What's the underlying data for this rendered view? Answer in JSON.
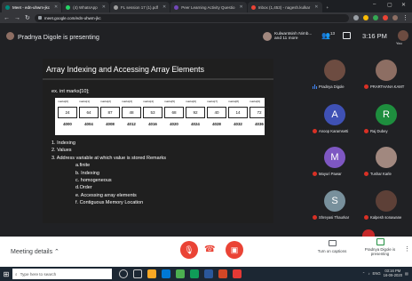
{
  "browser": {
    "tabs": [
      {
        "label": "Meet - edn-uhwm-jkc",
        "color": "#00897b",
        "active": true
      },
      {
        "label": "(4) WhatsApp",
        "color": "#25d366",
        "active": false
      },
      {
        "label": "FL session 17 (1).pdf",
        "color": "#9e9e9e",
        "active": false
      },
      {
        "label": "Peer Learning Activity Questio",
        "color": "#7248b9",
        "active": false
      },
      {
        "label": "Inbox (1,453) - nagesh.kulkar",
        "color": "#ea4335",
        "active": false
      }
    ],
    "new_tab": "+",
    "url": "meet.google.com/edn-uhwm-jkc"
  },
  "meet": {
    "presenter_label": "Pradnya Digole is presenting",
    "participants_chip": "Kulwantsinh Nimb... and 11 more",
    "people_count": "13",
    "time": "3:16 PM",
    "you_label": "You",
    "meeting_details": "Meeting details",
    "captions_label": "Turn on captions",
    "presenting_label": "Pradnya Digole is presenting"
  },
  "slide": {
    "title": "Array Indexing and Accessing Array Elements",
    "example": "ex. int marks[10];",
    "headers": [
      "marks[0]",
      "marks[1]",
      "marks[2]",
      "marks[3]",
      "marks[4]",
      "marks[5]",
      "marks[6]",
      "marks[7]",
      "marks[8]",
      "marks[9]"
    ],
    "values": [
      "24",
      "64",
      "87",
      "48",
      "53",
      "68",
      "92",
      "40",
      "14",
      "72"
    ],
    "addresses": [
      "4000",
      "4004",
      "4008",
      "4012",
      "4016",
      "4020",
      "4024",
      "4028",
      "4032",
      "4036"
    ],
    "points": [
      "1. Indexing",
      "2. Values",
      "3. Address variable at which value is stored Remarks"
    ],
    "subpoints": [
      "a.finite",
      "b. Indexing",
      "c. homogeneous",
      "d.Order",
      "e. Accessing array elements",
      "f. Contiguous Memory Location"
    ]
  },
  "participants": [
    {
      "name": "Pradnya Digole",
      "initial": "",
      "color": "#6d4c41",
      "muted": false
    },
    {
      "name": "PRARTHANA KAMT",
      "initial": "",
      "color": "#8d6e63",
      "muted": true
    },
    {
      "name": "Anoop Karamsetti",
      "initial": "A",
      "color": "#3f51b5",
      "muted": true
    },
    {
      "name": "Raj Dubey",
      "initial": "R",
      "color": "#1e8e3e",
      "muted": true
    },
    {
      "name": "Mayuri Pawar",
      "initial": "M",
      "color": "#7e57c2",
      "muted": true
    },
    {
      "name": "Tushar Karle",
      "initial": "",
      "color": "#a1887f",
      "muted": true
    },
    {
      "name": "Shreyasi Thaurkar",
      "initial": "S",
      "color": "#78909c",
      "muted": true
    },
    {
      "name": "Kalpesh sonawane",
      "initial": "",
      "color": "#5d4037",
      "muted": true
    }
  ],
  "taskbar": {
    "search_placeholder": "Type here to search",
    "tray_lang": "ENG",
    "tray_time": "03:16 PM",
    "tray_date": "16-09-2020"
  },
  "colors": {
    "end_call": "#ea4335",
    "accent": "#1a73e8"
  }
}
